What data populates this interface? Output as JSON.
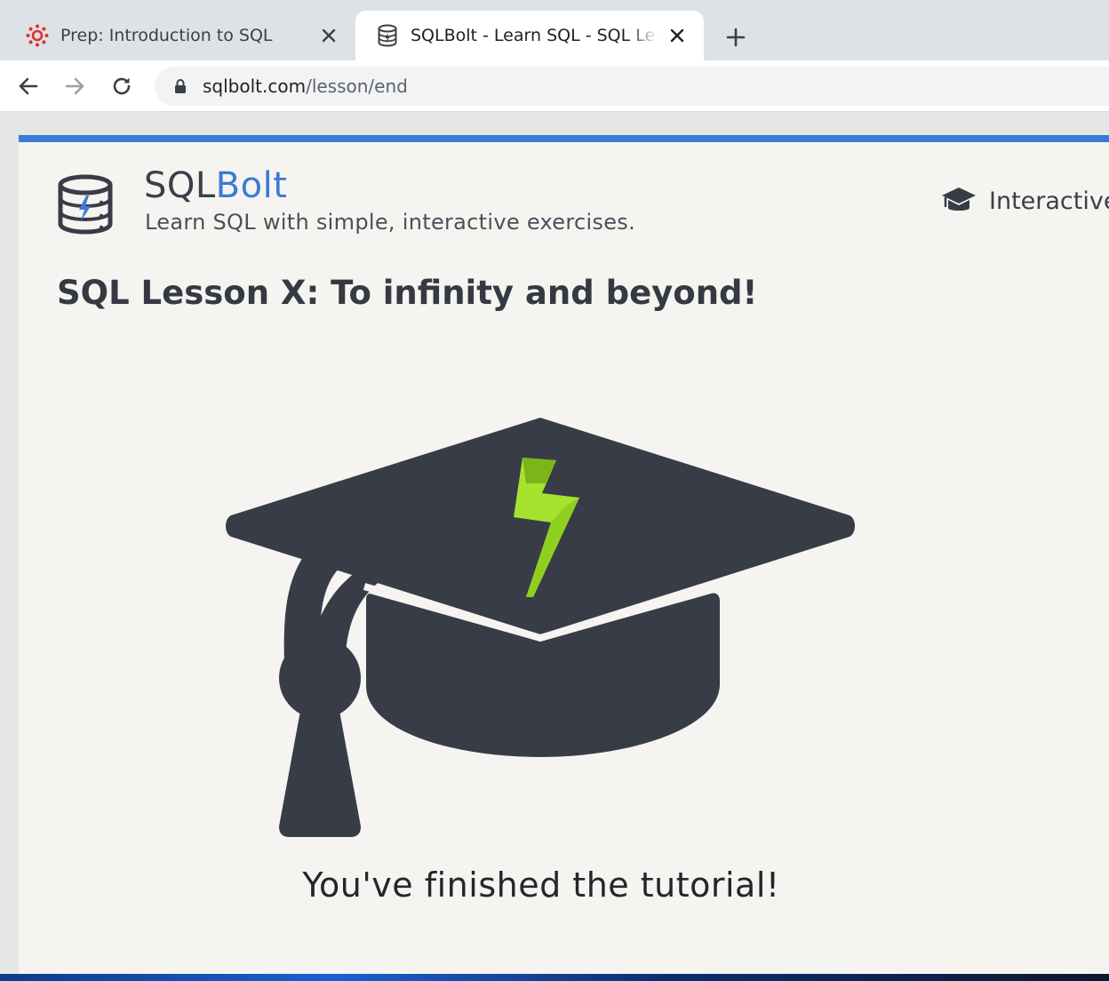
{
  "browser": {
    "tabs": [
      {
        "title": "Prep: Introduction to SQL",
        "favicon": "canvas-icon",
        "active": false
      },
      {
        "title": "SQLBolt - Learn SQL - SQL Lesson X: To infinity and beyond!",
        "favicon": "database-icon",
        "active": true
      }
    ],
    "address": {
      "host": "sqlbolt.com",
      "path": "/lesson/end"
    }
  },
  "site": {
    "brand_plain": "SQL",
    "brand_accent": "Bolt",
    "tagline": "Learn SQL with simple, interactive exercises.",
    "nav_label": "Interactive"
  },
  "lesson": {
    "title": "SQL Lesson X: To infinity and beyond!",
    "message": "You've finished the tutorial!"
  },
  "colors": {
    "accent": "#3a7bd5",
    "cap": "#383c46",
    "bolt": "#a6e22e"
  }
}
